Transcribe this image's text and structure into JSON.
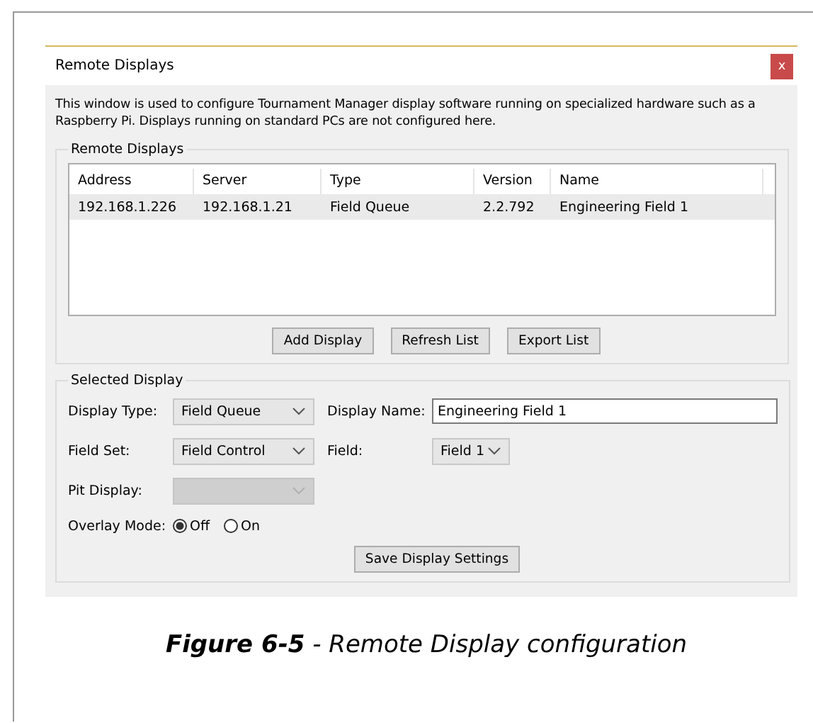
{
  "window": {
    "title": "Remote Displays",
    "close_label": "x"
  },
  "description": "This window is used to configure Tournament Manager display software running on specialized hardware such as a Raspberry Pi. Displays running on standard PCs are not configured here.",
  "remote_displays": {
    "label": "Remote Displays",
    "columns": [
      "Address",
      "Server",
      "Type",
      "Version",
      "Name"
    ],
    "rows": [
      {
        "cells": [
          "192.168.1.226",
          "192.168.1.21",
          "Field Queue",
          "2.2.792",
          "Engineering Field 1"
        ],
        "selected": true
      }
    ],
    "buttons": [
      "Add Display",
      "Refresh List",
      "Export List"
    ]
  },
  "selected_display": {
    "label": "Selected Display",
    "rows": [
      {
        "fields": [
          {
            "label": "Display Type:",
            "kind": "dropdown",
            "value": "Field Queue",
            "disabled": false
          },
          {
            "label": "Display Name:",
            "kind": "input",
            "value": "Engineering Field 1"
          }
        ]
      },
      {
        "fields": [
          {
            "label": "Field Set:",
            "kind": "dropdown",
            "value": "Field Control",
            "disabled": false
          },
          {
            "label": "Field:",
            "kind": "small-dropdown",
            "value": "Field 1",
            "disabled": false
          }
        ]
      },
      {
        "fields": [
          {
            "label": "Pit Display:",
            "kind": "dropdown",
            "disabled": true
          }
        ]
      }
    ],
    "overlay_mode": {
      "label": "Overlay Mode:",
      "options": [
        {
          "label": "Off",
          "selected": true
        },
        {
          "label": "On",
          "selected": false
        }
      ]
    },
    "save_button": "Save Display Settings"
  },
  "caption": "**Figure 6-5** - Remote Display configuration"
}
